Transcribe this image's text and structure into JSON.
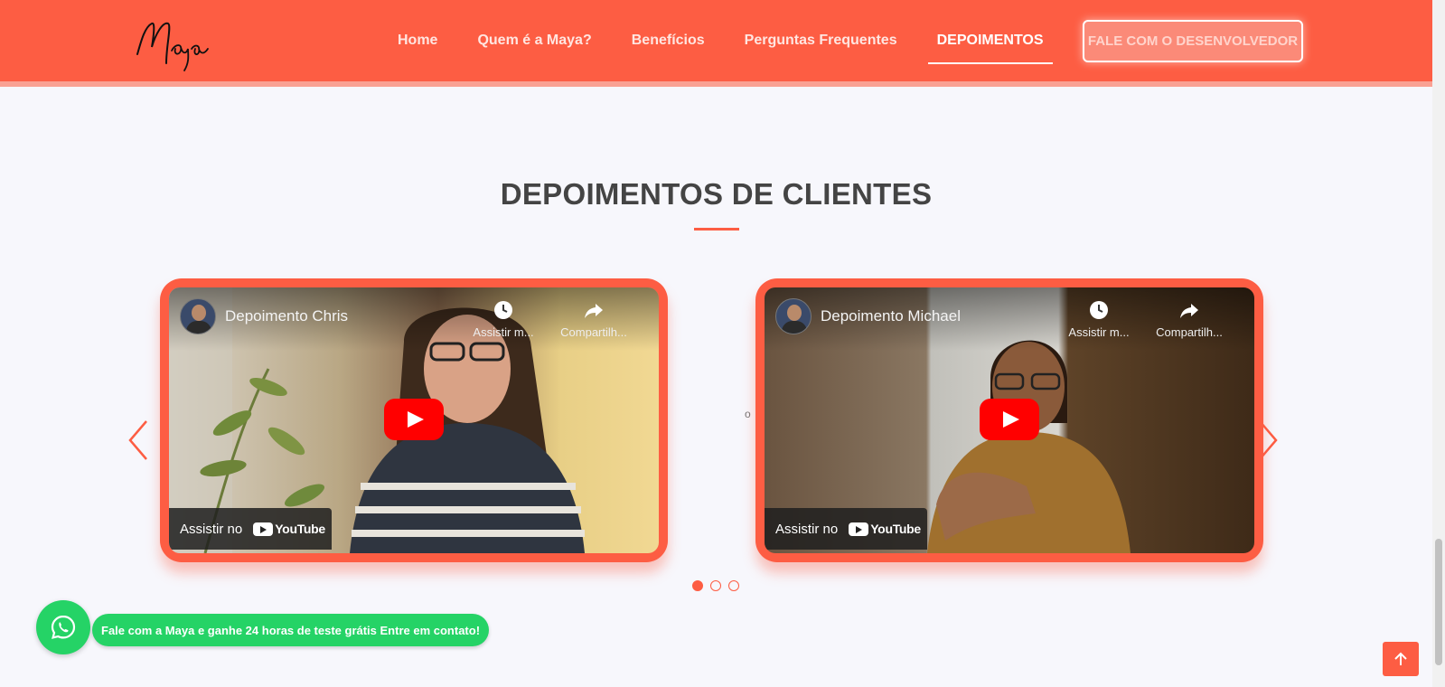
{
  "brand": {
    "logo_text": "Maya",
    "accent": "#fd5d43"
  },
  "nav": {
    "items": [
      {
        "label": "Home",
        "active": false
      },
      {
        "label": "Quem é a Maya?",
        "active": false
      },
      {
        "label": "Benefícios",
        "active": false
      },
      {
        "label": "Perguntas Frequentes",
        "active": false
      },
      {
        "label": "DEPOIMENTOS",
        "active": true
      }
    ],
    "cta_label": "FALE COM O DESENVOLVEDOR"
  },
  "section": {
    "title": "DEPOIMENTOS DE CLIENTES"
  },
  "carousel": {
    "videos": [
      {
        "title": "Depoimento Chris",
        "watch_later": "Assistir m...",
        "share": "Compartilh...",
        "watch_on": "Assistir no",
        "platform": "YouTube"
      },
      {
        "title": "Depoimento Michael",
        "watch_later": "Assistir m...",
        "share": "Compartilh...",
        "watch_on": "Assistir no",
        "platform": "YouTube"
      }
    ],
    "stray_char": "o",
    "page_count": 3,
    "active_page": 1
  },
  "whatsapp": {
    "bubble_text": "Fale com a Maya e ganhe 24 horas de teste grátis Entre em contato!",
    "color": "#25d366"
  }
}
